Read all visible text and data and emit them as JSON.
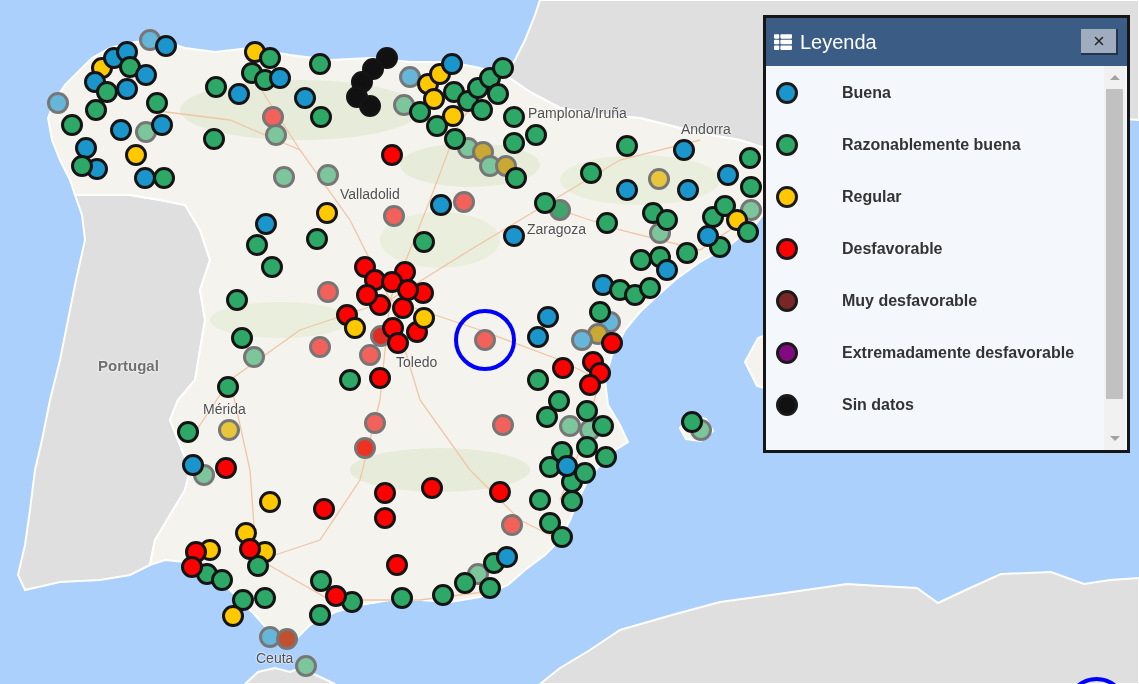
{
  "map": {
    "labels": [
      {
        "text": "Portugal",
        "kind": "country"
      },
      {
        "text": "Valladolid",
        "kind": "city"
      },
      {
        "text": "Zaragoza",
        "kind": "city"
      },
      {
        "text": "Pamplona/Iruña",
        "kind": "city"
      },
      {
        "text": "Andorra",
        "kind": "city"
      },
      {
        "text": "Toledo",
        "kind": "city"
      },
      {
        "text": "Mérida",
        "kind": "city"
      },
      {
        "text": "Ceuta",
        "kind": "city"
      }
    ],
    "faded_markers": [
      {
        "color": "#66b6da"
      },
      {
        "color": "#66b6da"
      },
      {
        "color": "#7dc59b"
      },
      {
        "color": "#f2625a"
      },
      {
        "color": "#7dc59b"
      },
      {
        "color": "#7dc59b"
      },
      {
        "color": "#66b6da"
      },
      {
        "color": "#7dc59b"
      },
      {
        "color": "#c9a834"
      },
      {
        "color": "#7dc59b"
      },
      {
        "color": "#c9a834"
      },
      {
        "color": "#f2625a"
      },
      {
        "color": "#f2625a"
      },
      {
        "color": "#7dc59b"
      },
      {
        "color": "#7dc59b"
      },
      {
        "color": "#3fa56c"
      },
      {
        "color": "#e8c63c"
      },
      {
        "color": "#7dc59b"
      },
      {
        "color": "#7dc59b"
      },
      {
        "color": "#66b6da"
      },
      {
        "color": "#c9a834"
      },
      {
        "color": "#66b6da"
      },
      {
        "color": "#f2625a"
      },
      {
        "color": "#e02a22"
      },
      {
        "color": "#f2625a"
      },
      {
        "color": "#f2625a"
      },
      {
        "color": "#f2625a"
      },
      {
        "color": "#7dc59b"
      },
      {
        "color": "#e8c63c"
      },
      {
        "color": "#f2625a"
      },
      {
        "color": "#ee3222"
      },
      {
        "color": "#7dc59b"
      },
      {
        "color": "#f2625a"
      },
      {
        "color": "#f2625a"
      },
      {
        "color": "#66b6da"
      },
      {
        "color": "#c0502e"
      },
      {
        "color": "#7dc59b"
      },
      {
        "color": "#7dc59b"
      },
      {
        "color": "#7dc59b"
      },
      {
        "color": "#7dc59b"
      },
      {
        "color": "#7dc59b"
      }
    ],
    "markers": [
      {
        "color": "#1a96cc"
      },
      {
        "color": "#ffc800"
      },
      {
        "color": "#1a96cc"
      },
      {
        "color": "#1a96cc"
      },
      {
        "color": "#2da866"
      },
      {
        "color": "#1a96cc"
      },
      {
        "color": "#1a96cc"
      },
      {
        "color": "#2da866"
      },
      {
        "color": "#1a96cc"
      },
      {
        "color": "#2da866"
      },
      {
        "color": "#2da866"
      },
      {
        "color": "#1a96cc"
      },
      {
        "color": "#1a96cc"
      },
      {
        "color": "#2da866"
      },
      {
        "color": "#1a96cc"
      },
      {
        "color": "#1a96cc"
      },
      {
        "color": "#2da866"
      },
      {
        "color": "#ffc800"
      },
      {
        "color": "#1a96cc"
      },
      {
        "color": "#2da866"
      },
      {
        "color": "#ffc800"
      },
      {
        "color": "#2da866"
      },
      {
        "color": "#2da866"
      },
      {
        "color": "#2da866"
      },
      {
        "color": "#1a96cc"
      },
      {
        "color": "#2da866"
      },
      {
        "color": "#1a96cc"
      },
      {
        "color": "#2da866"
      },
      {
        "color": "#1a96cc"
      },
      {
        "color": "#2da866"
      },
      {
        "color": "#2da866"
      },
      {
        "color": "#111111"
      },
      {
        "color": "#111111"
      },
      {
        "color": "#111111"
      },
      {
        "color": "#111111"
      },
      {
        "color": "#111111"
      },
      {
        "color": "#ffc800"
      },
      {
        "color": "#ffc800"
      },
      {
        "color": "#ffc800"
      },
      {
        "color": "#1a96cc"
      },
      {
        "color": "#2da866"
      },
      {
        "color": "#2da866"
      },
      {
        "color": "#2da866"
      },
      {
        "color": "#2da866"
      },
      {
        "color": "#2da866"
      },
      {
        "color": "#2da866"
      },
      {
        "color": "#2da866"
      },
      {
        "color": "#2da866"
      },
      {
        "color": "#ffc800"
      },
      {
        "color": "#2da866"
      },
      {
        "color": "#2da866"
      },
      {
        "color": "#2da866"
      },
      {
        "color": "#2da866"
      },
      {
        "color": "#2da866"
      },
      {
        "color": "#2da866"
      },
      {
        "color": "#ff0000"
      },
      {
        "color": "#1a96cc"
      },
      {
        "color": "#ffc800"
      },
      {
        "color": "#1a96cc"
      },
      {
        "color": "#2da866"
      },
      {
        "color": "#2da866"
      },
      {
        "color": "#2da866"
      },
      {
        "color": "#1a96cc"
      },
      {
        "color": "#2da866"
      },
      {
        "color": "#2da866"
      },
      {
        "color": "#1a96cc"
      },
      {
        "color": "#2da866"
      },
      {
        "color": "#2da866"
      },
      {
        "color": "#1a96cc"
      },
      {
        "color": "#1a96cc"
      },
      {
        "color": "#1a96cc"
      },
      {
        "color": "#2da866"
      },
      {
        "color": "#2da866"
      },
      {
        "color": "#2da866"
      },
      {
        "color": "#2da866"
      },
      {
        "color": "#2da866"
      },
      {
        "color": "#2da866"
      },
      {
        "color": "#ffc800"
      },
      {
        "color": "#2da866"
      },
      {
        "color": "#1a96cc"
      },
      {
        "color": "#2da866"
      },
      {
        "color": "#2da866"
      },
      {
        "color": "#2da866"
      },
      {
        "color": "#2da866"
      },
      {
        "color": "#1a96cc"
      },
      {
        "color": "#1a96cc"
      },
      {
        "color": "#2da866"
      },
      {
        "color": "#2da866"
      },
      {
        "color": "#2da866"
      },
      {
        "color": "#2da866"
      },
      {
        "color": "#1a96cc"
      },
      {
        "color": "#1a96cc"
      },
      {
        "color": "#ff0000"
      },
      {
        "color": "#ff0000"
      },
      {
        "color": "#ff0000"
      },
      {
        "color": "#ff0000"
      },
      {
        "color": "#ff0000"
      },
      {
        "color": "#2da866"
      },
      {
        "color": "#ff0000"
      },
      {
        "color": "#ff0000"
      },
      {
        "color": "#ff0000"
      },
      {
        "color": "#ff0000"
      },
      {
        "color": "#ff0000"
      },
      {
        "color": "#ff0000"
      },
      {
        "color": "#ff0000"
      },
      {
        "color": "#ff0000"
      },
      {
        "color": "#ff0000"
      },
      {
        "color": "#ffc800"
      },
      {
        "color": "#ff0000"
      },
      {
        "color": "#ff0000"
      },
      {
        "color": "#ff0000"
      },
      {
        "color": "#ffc800"
      },
      {
        "color": "#ff0000"
      },
      {
        "color": "#ff0000"
      },
      {
        "color": "#2da866"
      },
      {
        "color": "#2da866"
      },
      {
        "color": "#2da866"
      },
      {
        "color": "#2da866"
      },
      {
        "color": "#2da866"
      },
      {
        "color": "#2da866"
      },
      {
        "color": "#1a96cc"
      },
      {
        "color": "#ff0000"
      },
      {
        "color": "#ffc800"
      },
      {
        "color": "#ff0000"
      },
      {
        "color": "#ff0000"
      },
      {
        "color": "#ff0000"
      },
      {
        "color": "#ff0000"
      },
      {
        "color": "#ff0000"
      },
      {
        "color": "#ffc800"
      },
      {
        "color": "#ffc800"
      },
      {
        "color": "#2da866"
      },
      {
        "color": "#ff0000"
      },
      {
        "color": "#ffc800"
      },
      {
        "color": "#2da866"
      },
      {
        "color": "#2da866"
      },
      {
        "color": "#ff0000"
      },
      {
        "color": "#ff0000"
      },
      {
        "color": "#2da866"
      },
      {
        "color": "#2da866"
      },
      {
        "color": "#ffc800"
      },
      {
        "color": "#2da866"
      },
      {
        "color": "#2da866"
      },
      {
        "color": "#2da866"
      },
      {
        "color": "#ff0000"
      },
      {
        "color": "#ff0000"
      },
      {
        "color": "#2da866"
      },
      {
        "color": "#2da866"
      },
      {
        "color": "#2da866"
      },
      {
        "color": "#2da866"
      },
      {
        "color": "#1a96cc"
      },
      {
        "color": "#2da866"
      },
      {
        "color": "#2da866"
      },
      {
        "color": "#2da866"
      },
      {
        "color": "#2da866"
      },
      {
        "color": "#2da866"
      },
      {
        "color": "#2da866"
      },
      {
        "color": "#2da866"
      },
      {
        "color": "#2da866"
      },
      {
        "color": "#2da866"
      },
      {
        "color": "#2da866"
      },
      {
        "color": "#1a96cc"
      },
      {
        "color": "#2da866"
      },
      {
        "color": "#2da866"
      },
      {
        "color": "#2da866"
      },
      {
        "color": "#2da866"
      },
      {
        "color": "#2da866"
      },
      {
        "color": "#2da866"
      }
    ]
  },
  "legend": {
    "title": "Leyenda",
    "items": [
      {
        "label": "Buena",
        "color": "#1a96cc"
      },
      {
        "label": "Razonablemente buena",
        "color": "#2da866"
      },
      {
        "label": "Regular",
        "color": "#ffc800"
      },
      {
        "label": "Desfavorable",
        "color": "#ff0000"
      },
      {
        "label": "Muy desfavorable",
        "color": "#7b2626"
      },
      {
        "label": "Extremadamente desfavorable",
        "color": "#800a80"
      },
      {
        "label": "Sin datos",
        "color": "#111111"
      }
    ]
  }
}
